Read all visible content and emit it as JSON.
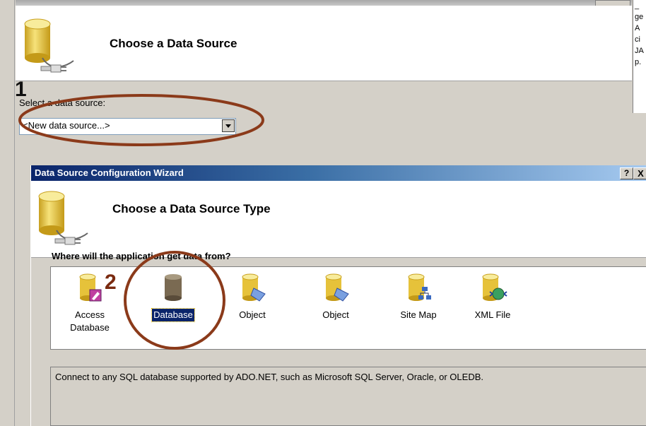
{
  "back_dialog": {
    "header_title": "Choose a Data Source",
    "select_label": "Select a data source:",
    "combo_value": "<New data source...>",
    "right_panel_fragments": [
      "_",
      "ge",
      "A",
      "ci",
      "JA",
      "p."
    ]
  },
  "front_dialog": {
    "title": "Data Source Configuration Wizard",
    "help_button": "?",
    "close_button": "X",
    "header_title": "Choose a Data Source Type",
    "question": "Where will the application get data from?",
    "sources": [
      {
        "label": "Access Database",
        "icon": "access-database-icon"
      },
      {
        "label": "Database",
        "icon": "database-icon",
        "selected": true
      },
      {
        "label": "Object",
        "icon": "object-icon"
      },
      {
        "label": "Object",
        "icon": "object-icon"
      },
      {
        "label": "Site Map",
        "icon": "site-map-icon"
      },
      {
        "label": "XML File",
        "icon": "xml-file-icon"
      }
    ],
    "description": "Connect to any SQL database supported by ADO.NET, such as Microsoft SQL Server, Oracle, or OLEDB."
  },
  "annotations": {
    "marker_1": "1",
    "marker_2": "2",
    "highlight_color": "#8b3a1a"
  },
  "colors": {
    "titlebar_start": "#0a246a",
    "titlebar_end": "#a6caf0",
    "dialog_face": "#d4d0c8",
    "selection": "#0a246a",
    "cylinder_yellow": "#e6c23a",
    "database_gray": "#7a6a52"
  }
}
